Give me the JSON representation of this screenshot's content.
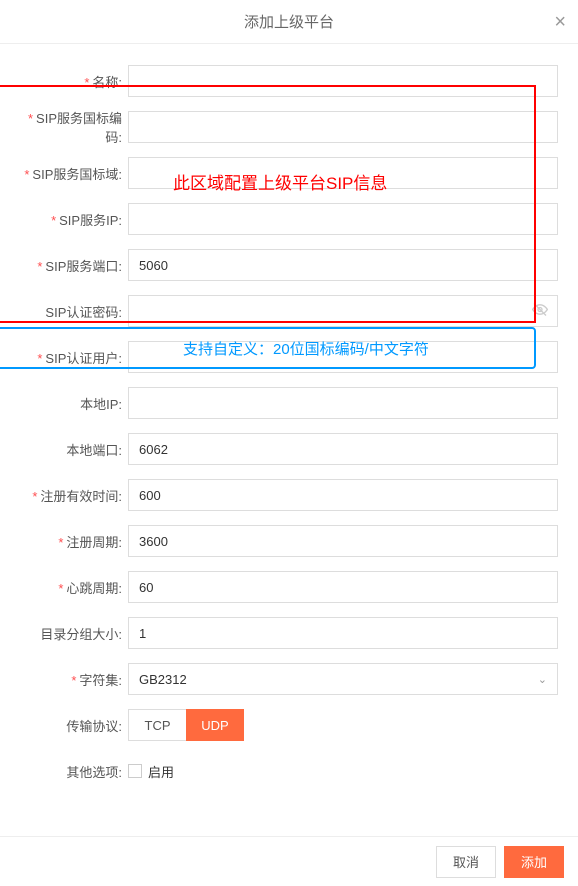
{
  "modal": {
    "title": "添加上级平台"
  },
  "form": {
    "name": {
      "label": "名称:",
      "value": ""
    },
    "sip_code": {
      "label": "SIP服务国标编码:",
      "value": ""
    },
    "sip_domain": {
      "label": "SIP服务国标域:",
      "value": ""
    },
    "sip_ip": {
      "label": "SIP服务IP:",
      "value": ""
    },
    "sip_port": {
      "label": "SIP服务端口:",
      "value": "5060"
    },
    "sip_password": {
      "label": "SIP认证密码:",
      "value": ""
    },
    "sip_user": {
      "label": "SIP认证用户:",
      "value": ""
    },
    "local_ip": {
      "label": "本地IP:",
      "value": ""
    },
    "local_port": {
      "label": "本地端口:",
      "value": "6062"
    },
    "reg_valid": {
      "label": "注册有效时间:",
      "value": "600"
    },
    "reg_period": {
      "label": "注册周期:",
      "value": "3600"
    },
    "heartbeat": {
      "label": "心跳周期:",
      "value": "60"
    },
    "dir_group": {
      "label": "目录分组大小:",
      "value": "1"
    },
    "charset": {
      "label": "字符集:",
      "value": "GB2312"
    },
    "protocol": {
      "label": "传输协议:",
      "tcp": "TCP",
      "udp": "UDP"
    },
    "other": {
      "label": "其他选项:",
      "enable": "启用"
    }
  },
  "footer": {
    "cancel": "取消",
    "submit": "添加"
  },
  "annotations": {
    "red_text": "此区域配置上级平台SIP信息",
    "blue_text": "支持自定义：20位国标编码/中文字符"
  },
  "icons": {
    "close": "×",
    "chevron": "⌄"
  }
}
